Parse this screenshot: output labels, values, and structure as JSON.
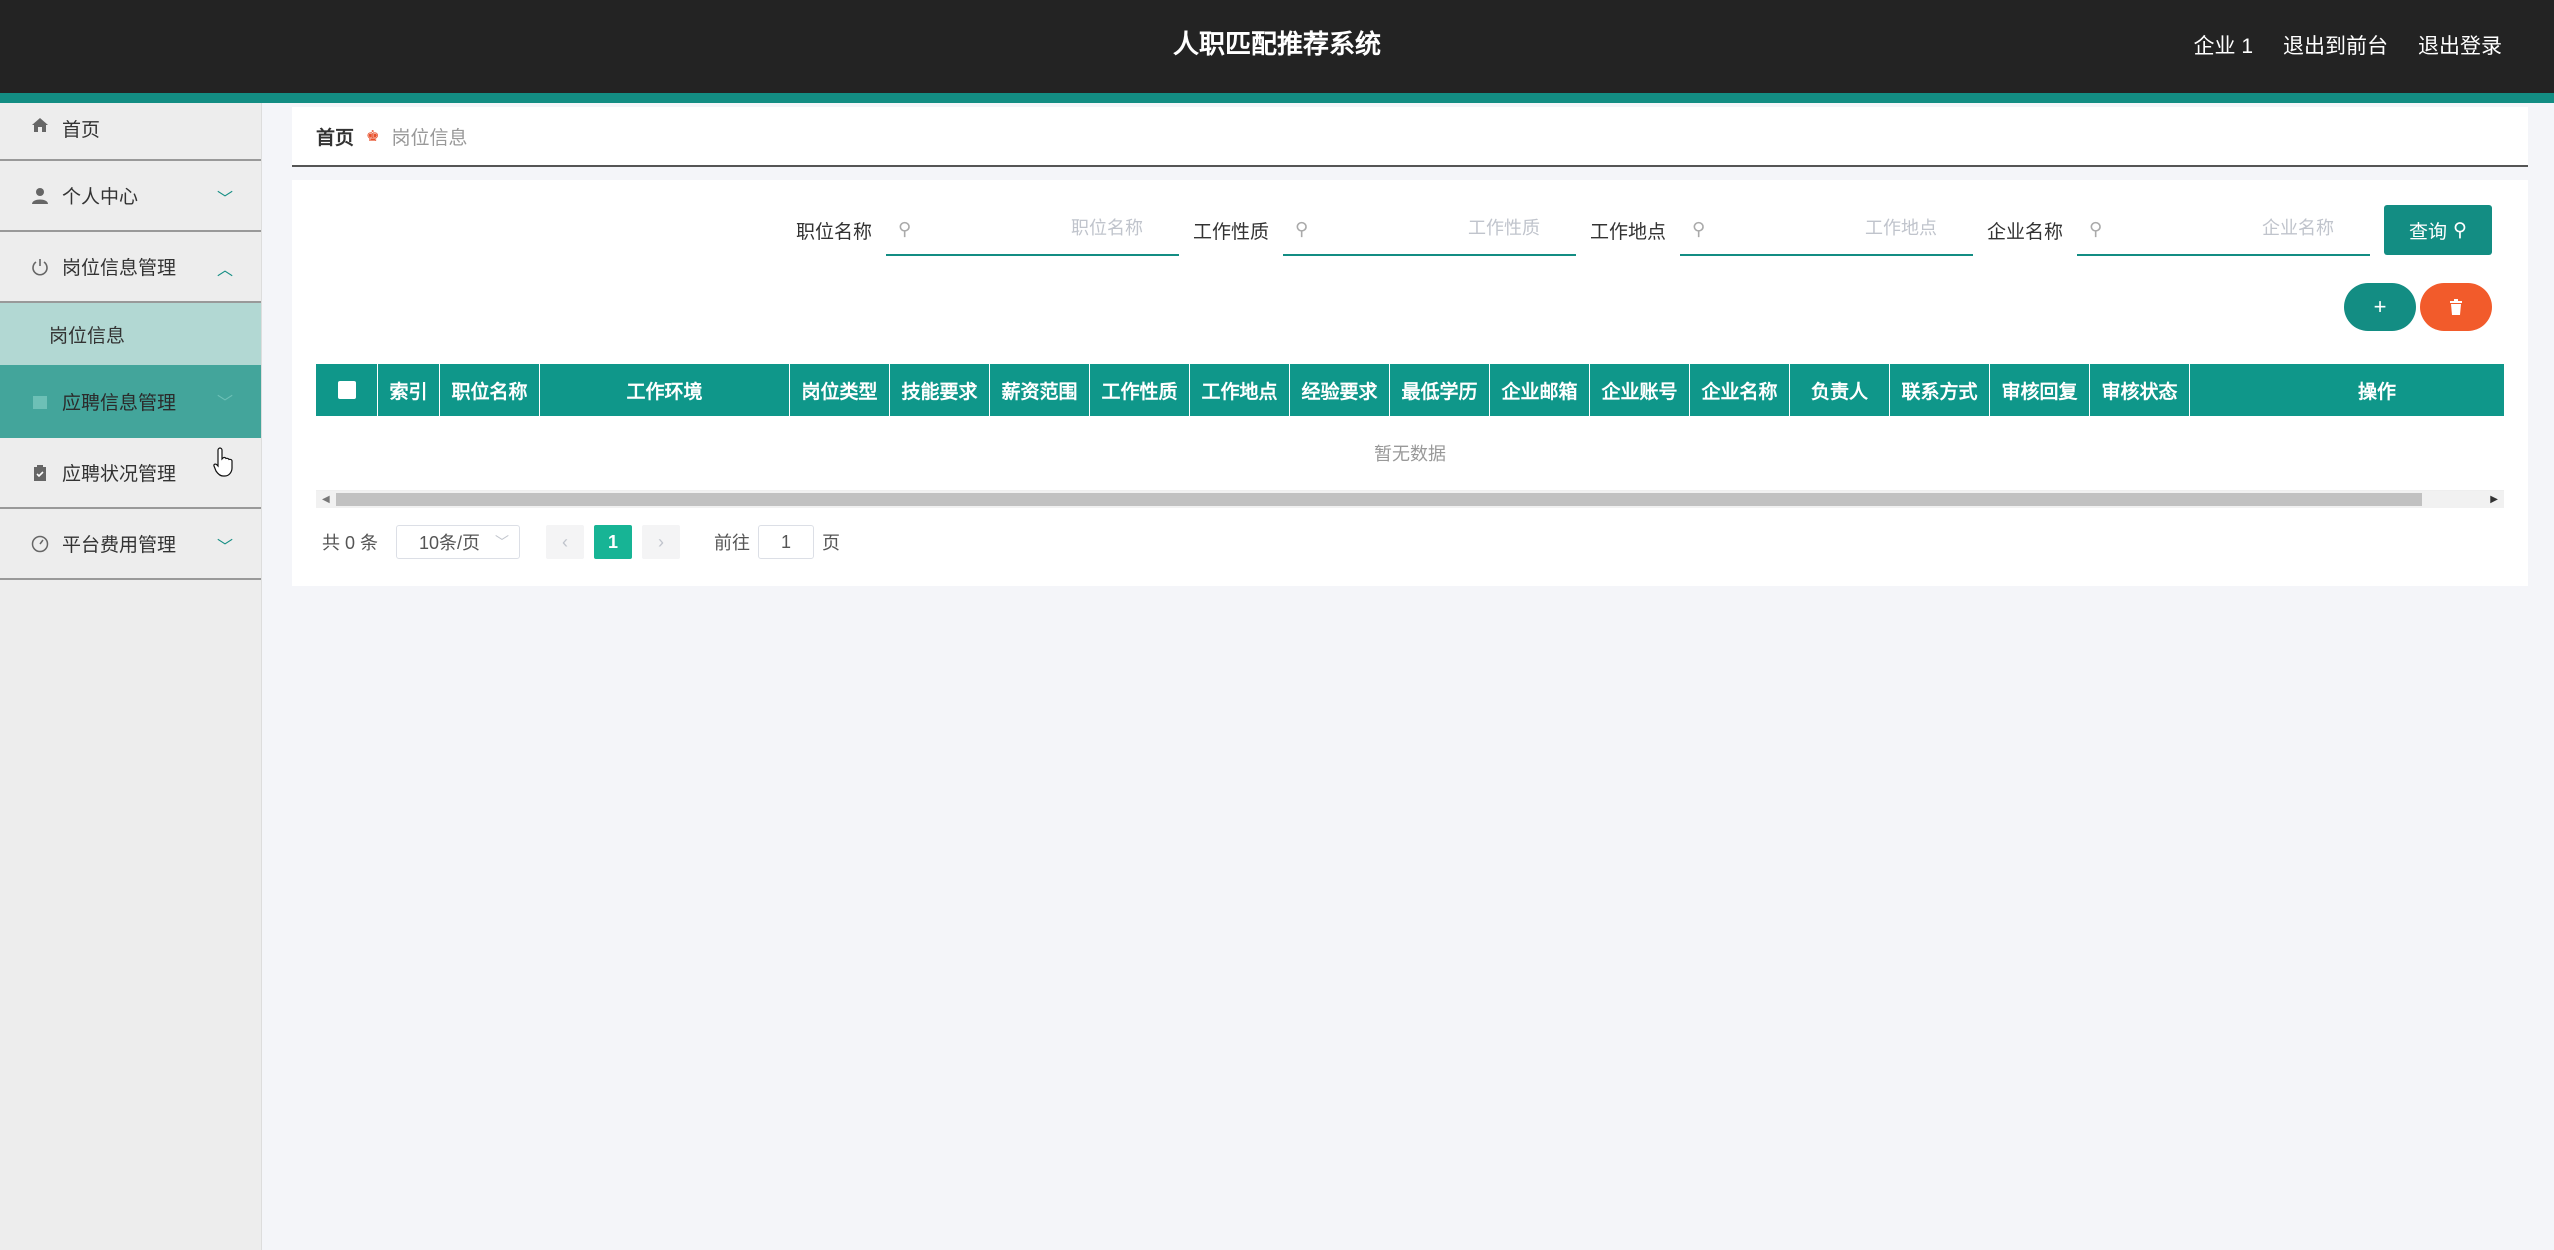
{
  "header": {
    "title": "人职匹配推荐系统",
    "links": [
      "企业 1",
      "退出到前台",
      "退出登录"
    ]
  },
  "sidebar": {
    "items": [
      {
        "label": "首页",
        "icon": "home-icon"
      },
      {
        "label": "个人中心",
        "icon": "user-icon"
      },
      {
        "label": "岗位信息管理",
        "icon": "power-icon",
        "sub": [
          "岗位信息"
        ]
      },
      {
        "label": "应聘信息管理",
        "icon": "calendar-icon"
      },
      {
        "label": "应聘状况管理",
        "icon": "clipboard-icon"
      },
      {
        "label": "平台费用管理",
        "icon": "gauge-icon"
      }
    ]
  },
  "breadcrumb": {
    "home": "首页",
    "current": "岗位信息"
  },
  "search": {
    "fields": [
      {
        "label": "职位名称",
        "placeholder": "职位名称"
      },
      {
        "label": "工作性质",
        "placeholder": "工作性质"
      },
      {
        "label": "工作地点",
        "placeholder": "工作地点"
      },
      {
        "label": "企业名称",
        "placeholder": "企业名称"
      }
    ],
    "query_label": "查询"
  },
  "table": {
    "columns": [
      "索引",
      "职位名称",
      "工作环境",
      "岗位类型",
      "技能要求",
      "薪资范围",
      "工作性质",
      "工作地点",
      "经验要求",
      "最低学历",
      "企业邮箱",
      "企业账号",
      "企业名称",
      "负责人",
      "联系方式",
      "审核回复",
      "审核状态",
      "操作"
    ],
    "empty_text": "暂无数据"
  },
  "pagination": {
    "total": "共 0 条",
    "page_size": "10条/页",
    "current_page": "1",
    "goto_label": "前往",
    "goto_value": "1",
    "page_suffix": "页"
  },
  "colors": {
    "header_bg": "#232323",
    "accent": "#138d83",
    "danger": "#f25b2b"
  }
}
